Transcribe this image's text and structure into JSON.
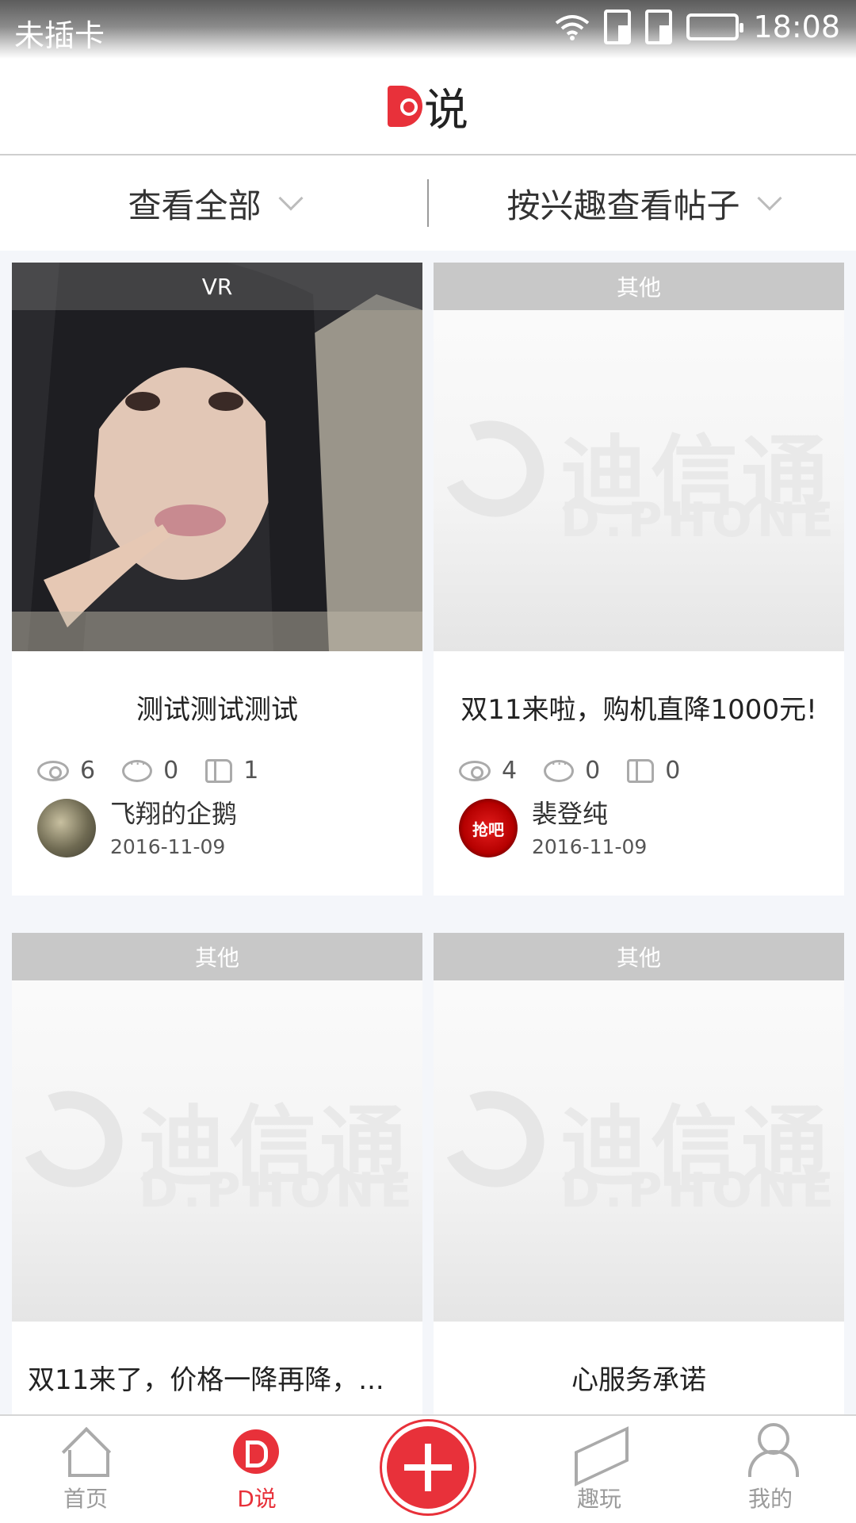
{
  "status_bar": {
    "carrier": "未插卡",
    "time": "18:08"
  },
  "header": {
    "title": "说"
  },
  "filters": {
    "left": "查看全部",
    "right": "按兴趣查看帖子"
  },
  "placeholder": {
    "logo_cn": "迪信通",
    "logo_en": "D.PHONE"
  },
  "posts": [
    {
      "tag": "VR",
      "title": "测试测试测试",
      "views": "6",
      "comments": "0",
      "likes": "1",
      "author": "飞翔的企鹅",
      "date": "2016-11-09"
    },
    {
      "tag": "其他",
      "title": "双11来啦，购机直降1000元!",
      "views": "4",
      "comments": "0",
      "likes": "0",
      "author": "裴登纯",
      "date": "2016-11-09",
      "avatar_text": "抢吧"
    },
    {
      "tag": "其他",
      "title": "双11来了，价格一降再降，..."
    },
    {
      "tag": "其他",
      "title": "心服务承诺"
    }
  ],
  "nav": {
    "home": "首页",
    "dsay": "D说",
    "play": "趣玩",
    "mine": "我的"
  },
  "colors": {
    "accent": "#e8313a"
  }
}
